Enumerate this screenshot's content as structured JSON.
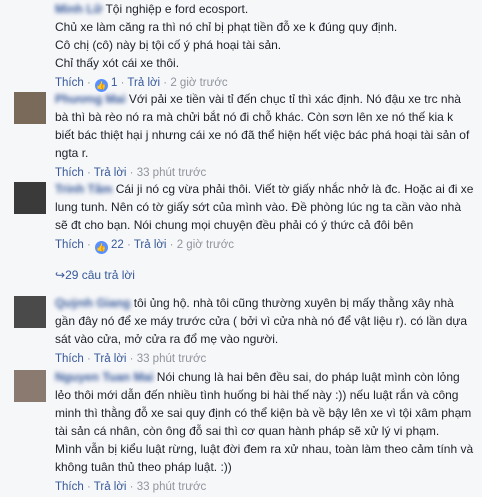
{
  "comments": [
    {
      "name": "Minh Lữ",
      "lines": [
        "Tội nghiệp e ford ecosport.",
        "Chủ xe làm căng ra thì nó chỉ bị phạt tiền đỗ xe k đúng quy định.",
        "Cô chị (cô) này bị tội cố ý phá hoại tài sản.",
        "Chỉ thấy xót cái xe thôi."
      ],
      "like_label": "Thích",
      "like_count": "1",
      "reply_label": "Trả lời",
      "time": "2 giờ trước"
    },
    {
      "name": "Phương Mai",
      "text": "Với pải xe tiền vài tỉ đến chục tỉ thì xác định. Nó đậu xe trc nhà bà thì bà rèo nó ra mà chửi bắt nó đi chỗ khác. Còn sơn lên xe nó thế kia k biết bác thiệt hại j nhưng cái xe nó đã thể hiện hết việc bác phá hoại tài sản of ngta r.",
      "like_label": "Thích",
      "reply_label": "Trả lời",
      "time": "33 phút trước"
    },
    {
      "name": "Trinh Tâm",
      "text": "Cái ji nó cg vừa phải thôi. Viết tờ giấy nhắc nhở là đc. Hoặc ai đi xe lung tunh. Nên có tờ giấy sớt của mình vào. Đề phòng lúc ng ta cần vào nhà sẽ đt cho bạn. Nói chung mọi chuyện đều phải có ý thức cả đôi bên",
      "like_label": "Thích",
      "like_count": "22",
      "reply_label": "Trả lời",
      "time": "2 giờ trước",
      "replies_label": "29 câu trả lời"
    },
    {
      "name": "Quỳnh Giang",
      "text": "tôi ủng hộ. nhà tôi cũng thường xuyên bị mấy thằng xây nhà gần đây nó để xe máy trước cửa ( bởi vì cửa nhà nó để vật liệu r). có lần dựa sát vào cửa, mở cửa ra đổ mẹ vào người.",
      "like_label": "Thích",
      "reply_label": "Trả lời",
      "time": "33 phút trước"
    },
    {
      "name": "Nguyen Tuan Mai",
      "text": "Nói chung là hai bên đều sai, do pháp luật mình còn lỏng lẻo thôi mới dẫn đến nhiều tình huống bi hài thế này :)) nếu luật rắn và công minh thì thằng đỗ xe sai quy định có thể kiện bà về bậy lên xe vì tội xâm phạm tài sản cá nhân, còn ông đỗ sai thì cơ quan hành pháp sẽ xử lý vi phạm.",
      "text2": "Mình vẫn bị kiểu luật rừng, luật đời đem ra xử nhau, toàn làm theo cảm tính và không tuân thủ theo pháp luật. :))",
      "like_label": "Thích",
      "reply_label": "Trả lời",
      "time": "33 phút trước"
    }
  ]
}
